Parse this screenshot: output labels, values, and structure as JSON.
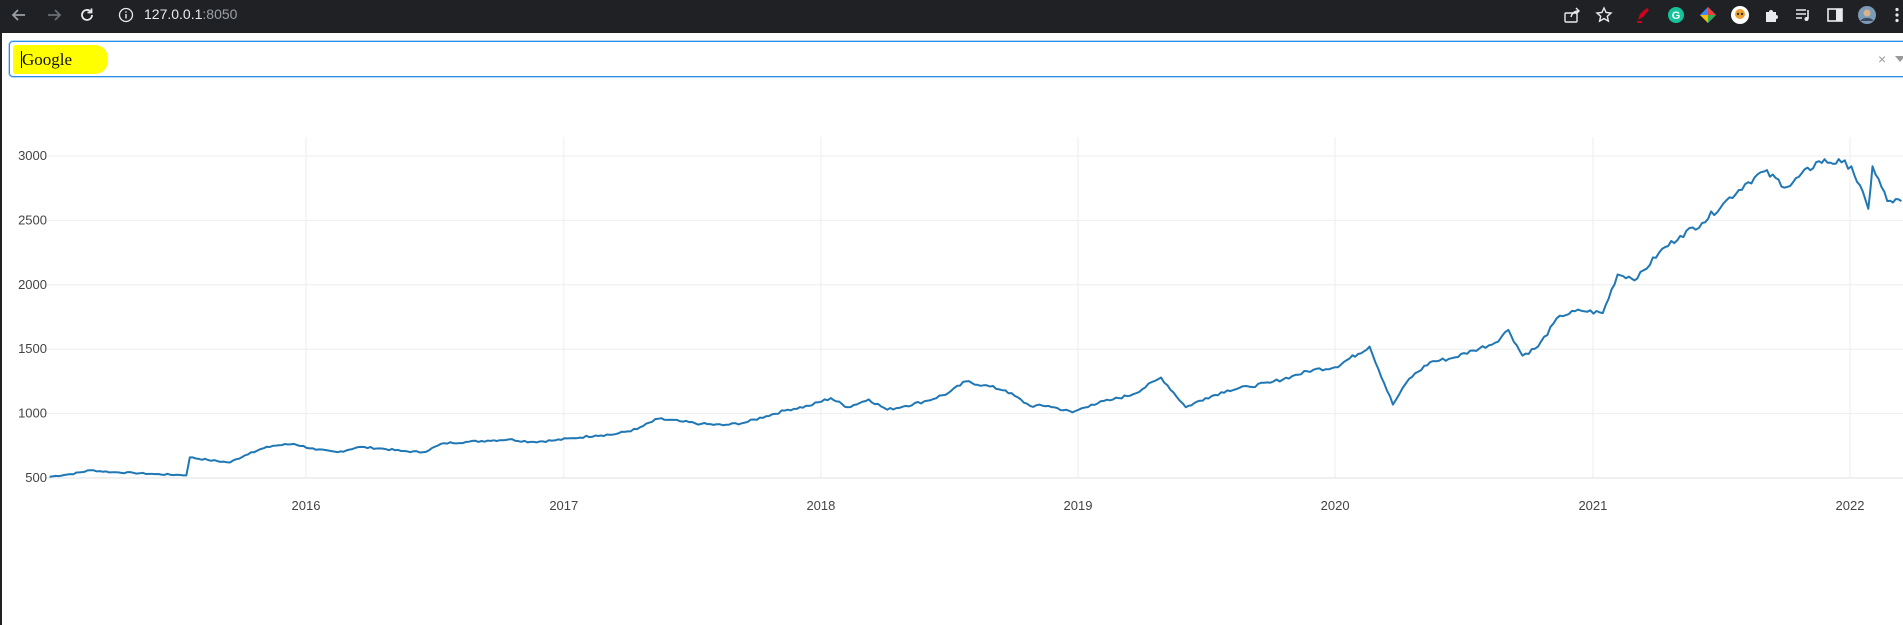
{
  "browser": {
    "url_host": "127.0.0.1",
    "url_port": ":8050",
    "toolbar_icons": [
      "share-icon",
      "star-icon",
      "pen-extension-icon",
      "grammarly-icon",
      "color-picker-icon",
      "avatar-extension-icon",
      "puzzle-icon",
      "media-queue-icon",
      "sidebar-icon",
      "profile-avatar",
      "kebab-menu-icon"
    ]
  },
  "dropdown": {
    "value": "Google",
    "clear_symbol": "×",
    "highlight_color": "#ffff00",
    "border_color": "#2b8ee6"
  },
  "chart_data": {
    "type": "line",
    "xlabel": "",
    "ylabel": "",
    "title": "",
    "grid": true,
    "line_color": "#1f77b4",
    "ylim": [
      475,
      3050
    ],
    "y_ticks": [
      500,
      1000,
      1500,
      2000,
      2500,
      3000
    ],
    "x_ticks": [
      "2016",
      "2017",
      "2018",
      "2019",
      "2020",
      "2021",
      "2022"
    ],
    "series": [
      {
        "x": [
          "2015-01-02",
          "2015-02-01",
          "2015-03-01",
          "2015-04-01",
          "2015-05-01",
          "2015-06-01",
          "2015-07-01",
          "2015-07-15",
          "2015-07-20",
          "2015-08-15",
          "2015-09-15",
          "2015-10-15",
          "2015-11-15",
          "2015-12-15",
          "2016-01-15",
          "2016-02-15",
          "2016-03-15",
          "2016-04-15",
          "2016-05-15",
          "2016-06-15",
          "2016-07-15",
          "2016-08-15",
          "2016-09-15",
          "2016-10-15",
          "2016-11-15",
          "2016-12-15",
          "2017-01-15",
          "2017-02-15",
          "2017-03-15",
          "2017-04-15",
          "2017-05-15",
          "2017-06-15",
          "2017-07-15",
          "2017-08-15",
          "2017-09-15",
          "2017-10-15",
          "2017-11-15",
          "2017-12-15",
          "2018-01-15",
          "2018-02-08",
          "2018-03-10",
          "2018-04-05",
          "2018-05-01",
          "2018-06-01",
          "2018-07-01",
          "2018-07-26",
          "2018-08-20",
          "2018-09-20",
          "2018-10-25",
          "2018-11-20",
          "2018-12-24",
          "2019-01-20",
          "2019-02-20",
          "2019-03-20",
          "2019-04-29",
          "2019-06-03",
          "2019-07-01",
          "2019-08-01",
          "2019-09-01",
          "2019-10-01",
          "2019-11-01",
          "2019-12-01",
          "2020-01-01",
          "2020-02-19",
          "2020-03-23",
          "2020-04-15",
          "2020-05-15",
          "2020-06-15",
          "2020-07-15",
          "2020-08-15",
          "2020-09-03",
          "2020-09-23",
          "2020-10-15",
          "2020-11-15",
          "2020-12-15",
          "2021-01-15",
          "2021-02-05",
          "2021-03-05",
          "2021-04-05",
          "2021-05-05",
          "2021-06-05",
          "2021-07-05",
          "2021-08-05",
          "2021-09-01",
          "2021-10-04",
          "2021-11-18",
          "2021-12-20",
          "2022-01-03",
          "2022-01-27",
          "2022-02-02",
          "2022-02-23",
          "2022-03-15"
        ],
        "y": [
          510,
          530,
          560,
          545,
          540,
          530,
          525,
          520,
          660,
          640,
          620,
          700,
          750,
          765,
          720,
          700,
          740,
          730,
          710,
          700,
          770,
          780,
          790,
          800,
          780,
          790,
          810,
          830,
          840,
          880,
          960,
          940,
          920,
          910,
          930,
          980,
          1030,
          1060,
          1120,
          1050,
          1110,
          1030,
          1060,
          1100,
          1160,
          1250,
          1220,
          1180,
          1060,
          1060,
          1010,
          1070,
          1110,
          1150,
          1280,
          1050,
          1120,
          1180,
          1210,
          1240,
          1290,
          1340,
          1360,
          1520,
          1070,
          1270,
          1400,
          1430,
          1490,
          1550,
          1650,
          1450,
          1520,
          1760,
          1800,
          1780,
          2080,
          2050,
          2250,
          2380,
          2480,
          2630,
          2780,
          2880,
          2760,
          2960,
          2950,
          2920,
          2590,
          2920,
          2650,
          2650
        ]
      }
    ]
  }
}
